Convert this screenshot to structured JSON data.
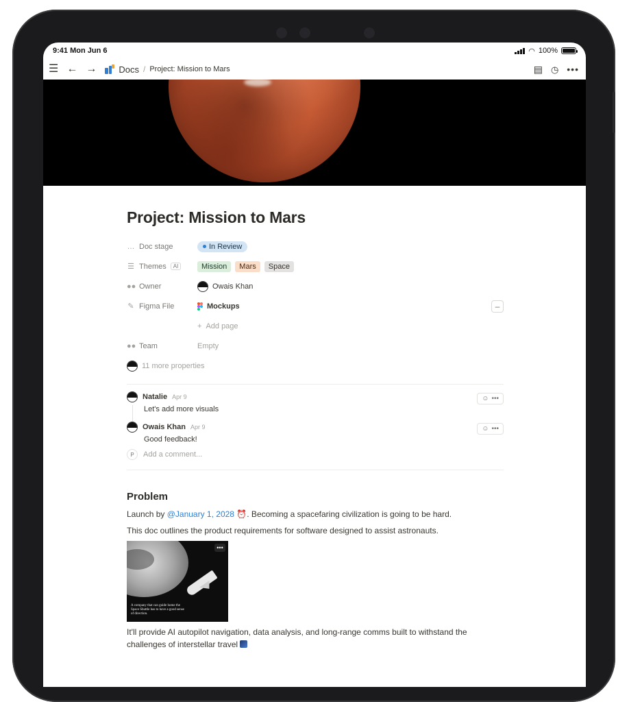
{
  "status": {
    "time": "9:41",
    "date": "Mon Jun 6",
    "battery": "100%"
  },
  "toolbar": {
    "menu_icon": "hamburger-icon",
    "back_icon": "arrow-left-icon",
    "forward_icon": "arrow-right-icon",
    "breadcrumb_root": "Docs",
    "breadcrumb_sep": "/",
    "breadcrumb_page": "Project: Mission to Mars",
    "comments_icon": "comment-icon",
    "history_icon": "clock-icon",
    "more_icon": "more-icon"
  },
  "page": {
    "title": "Project: Mission to Mars",
    "properties": {
      "doc_stage": {
        "label": "Doc stage",
        "value": "In Review",
        "color": "#d3e5f5"
      },
      "themes": {
        "label": "Themes",
        "ai_badge": "AI",
        "tags": [
          {
            "text": "Mission",
            "color": "#dbeddb"
          },
          {
            "text": "Mars",
            "color": "#fadec9"
          },
          {
            "text": "Space",
            "color": "#e3e2e0"
          }
        ]
      },
      "owner": {
        "label": "Owner",
        "value": "Owais Khan"
      },
      "figma": {
        "label": "Figma File",
        "value": "Mockups",
        "add_page": "Add page"
      },
      "team": {
        "label": "Team",
        "value": "Empty"
      },
      "more": "11 more properties"
    },
    "comments": [
      {
        "author": "Natalie",
        "date": "Apr 9",
        "text": "Let's add more visuals"
      },
      {
        "author": "Owais Khan",
        "date": "Apr 9",
        "text": "Good feedback!"
      }
    ],
    "add_comment": {
      "avatar_letter": "P",
      "placeholder": "Add a comment..."
    },
    "problem": {
      "heading": "Problem",
      "p1_prefix": "Launch by ",
      "p1_mention": "@January 1, 2028",
      "p1_suffix": ". Becoming a spacefaring civilization is going to be hard.",
      "p2": "This doc outlines the product requirements for software designed to assist astronauts.",
      "image_caption": "A company that can guide home the Space Shuttle has to have a good sense of direction.",
      "p3": "It'll provide AI autopilot navigation, data analysis, and long-range comms built to withstand the challenges of interstellar travel"
    }
  }
}
